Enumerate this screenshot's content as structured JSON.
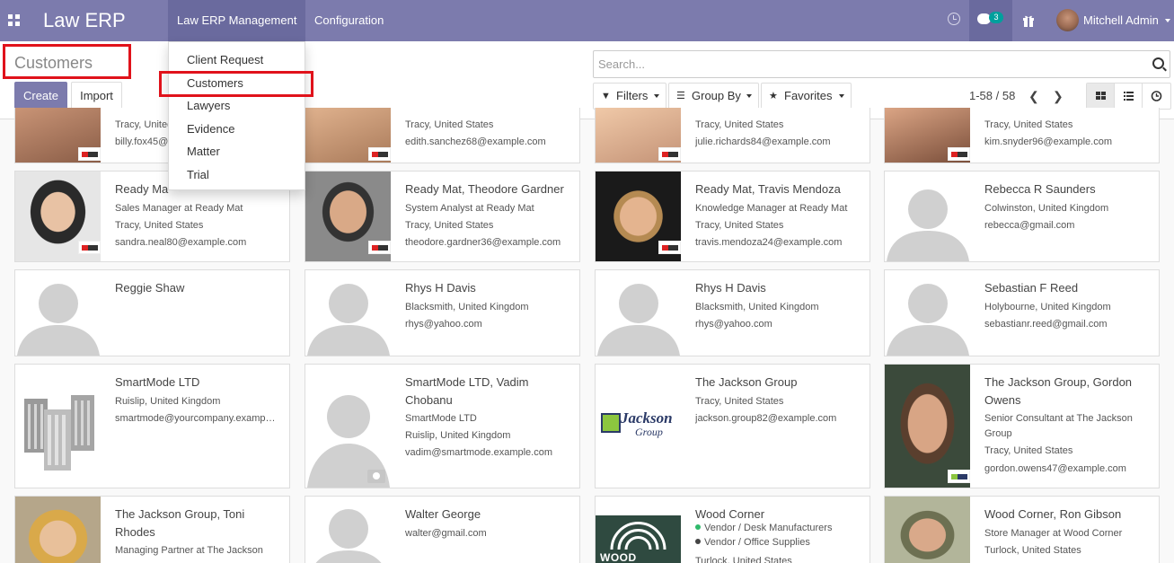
{
  "nav": {
    "brand": "Law ERP",
    "menu_main": "Law ERP Management",
    "menu_config": "Configuration",
    "chat_count": "3",
    "user_name": "Mitchell Admin"
  },
  "control": {
    "title": "Customers",
    "create": "Create",
    "import": "Import",
    "search_placeholder": "Search...",
    "filters": "Filters",
    "group_by": "Group By",
    "favorites": "Favorites",
    "pager": "1-58 / 58"
  },
  "dropdown": [
    "Client Request",
    "Customers",
    "Lawyers",
    "Evidence",
    "Matter",
    "Trial"
  ],
  "cards": {
    "r0c0": {
      "name": "",
      "lines": [
        "Tracy, United",
        "billy.fox45@"
      ]
    },
    "r0c1": {
      "name": "",
      "lines": [
        "Tracy, United States",
        "edith.sanchez68@example.com"
      ]
    },
    "r0c2": {
      "name": "",
      "lines": [
        "Tracy, United States",
        "julie.richards84@example.com"
      ]
    },
    "r0c3": {
      "name": "",
      "lines": [
        "Tracy, United States",
        "kim.snyder96@example.com"
      ]
    },
    "r1c0": {
      "name": "Ready Ma",
      "lines": [
        "Sales Manager at Ready Mat",
        "Tracy, United States",
        "sandra.neal80@example.com"
      ]
    },
    "r1c1": {
      "name": "Ready Mat, Theodore Gardner",
      "lines": [
        "System Analyst at Ready Mat",
        "Tracy, United States",
        "theodore.gardner36@example.com"
      ]
    },
    "r1c2": {
      "name": "Ready Mat, Travis Mendoza",
      "lines": [
        "Knowledge Manager at Ready Mat",
        "Tracy, United States",
        "travis.mendoza24@example.com"
      ]
    },
    "r1c3": {
      "name": "Rebecca R Saunders",
      "lines": [
        "Colwinston, United Kingdom",
        "rebecca@gmail.com"
      ]
    },
    "r2c0": {
      "name": "Reggie Shaw",
      "lines": []
    },
    "r2c1": {
      "name": "Rhys H Davis",
      "lines": [
        "Blacksmith, United Kingdom",
        "rhys@yahoo.com"
      ]
    },
    "r2c2": {
      "name": "Rhys H Davis",
      "lines": [
        "Blacksmith, United Kingdom",
        "rhys@yahoo.com"
      ]
    },
    "r2c3": {
      "name": "Sebastian F Reed",
      "lines": [
        "Holybourne, United Kingdom",
        "sebastianr.reed@gmail.com"
      ]
    },
    "r3c0": {
      "name": "SmartMode LTD",
      "lines": [
        "Ruislip, United Kingdom",
        "smartmode@yourcompany.examp…"
      ]
    },
    "r3c1": {
      "name": "SmartMode LTD, Vadim Chobanu",
      "lines": [
        "SmartMode LTD",
        "Ruislip, United Kingdom",
        "vadim@smartmode.example.com"
      ]
    },
    "r3c2": {
      "name": "The Jackson Group",
      "lines": [
        "Tracy, United States",
        "jackson.group82@example.com"
      ]
    },
    "r3c3": {
      "name": "The Jackson Group, Gordon Owens",
      "lines": [
        "Senior Consultant at The Jackson",
        "Group",
        "Tracy, United States",
        "gordon.owens47@example.com"
      ]
    },
    "r4c0": {
      "name": "The Jackson Group, Toni Rhodes",
      "lines": [
        "Managing Partner at The Jackson"
      ]
    },
    "r4c1": {
      "name": "Walter George",
      "lines": [
        "walter@gmail.com"
      ]
    },
    "r4c2": {
      "name": "Wood Corner",
      "lines": [
        "Vendor / Desk Manufacturers",
        "Vendor / Office Supplies",
        "Turlock, United States"
      ]
    },
    "r4c3": {
      "name": "Wood Corner, Ron Gibson",
      "lines": [
        "Store Manager at Wood Corner",
        "Turlock, United States"
      ]
    }
  },
  "logos": {
    "jackson_line1": "Jackson",
    "jackson_line2": "Group",
    "wood": "WOOD CORNER",
    "readymat": "READY MAT"
  },
  "colors": {
    "brand": "#7c7bad",
    "highlight": "#e0121b",
    "tag_green": "#2fb96b",
    "tag_dark": "#444444"
  }
}
